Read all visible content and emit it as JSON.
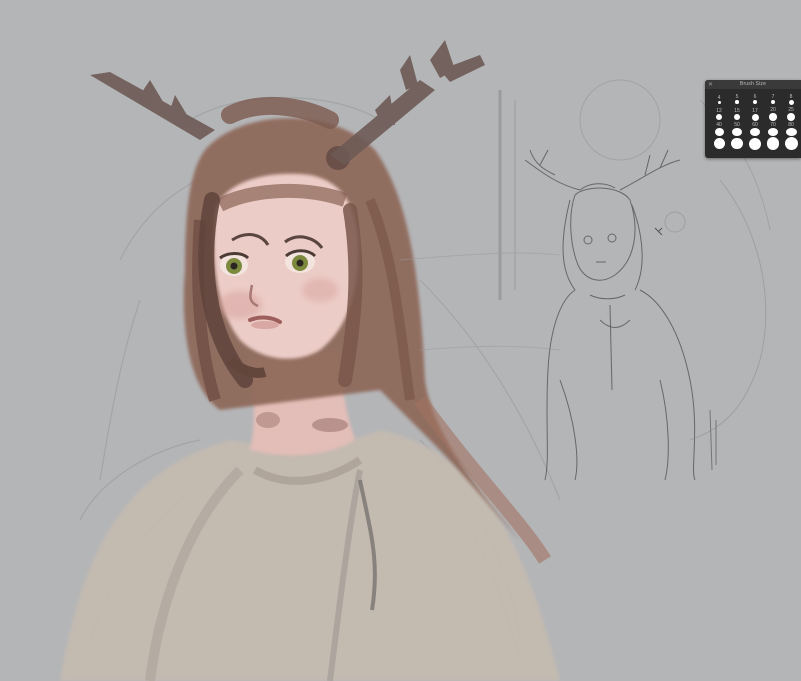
{
  "app": {
    "canvas_background": "#b4b5b7"
  },
  "brush_panel": {
    "title": "Brush Size",
    "close_icon": "close-icon",
    "sizes": [
      "4",
      "5",
      "6",
      "7",
      "8",
      "12",
      "15",
      "17",
      "20",
      "25",
      "40",
      "50",
      "60",
      "70",
      "80",
      "",
      "",
      "",
      "",
      ""
    ]
  },
  "artwork": {
    "skin_color": "#e8c6c2",
    "hair_color": "#8a6558",
    "antler_color": "#6e5a55",
    "eye_color": "#7c8a3e",
    "shirt_color": "#c6bbb0",
    "sketch_line_color": "#5a5a5a"
  }
}
